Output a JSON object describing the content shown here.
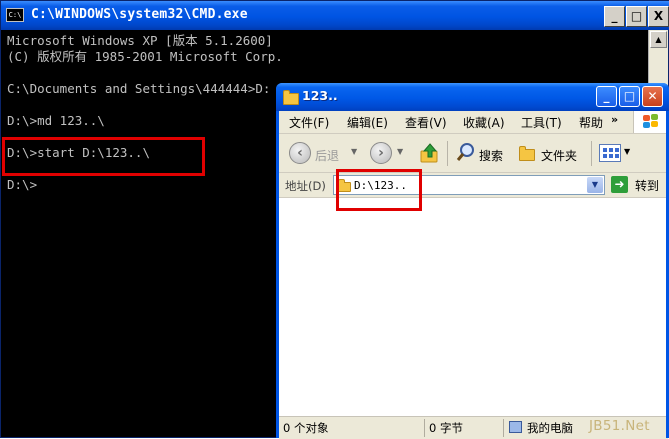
{
  "cmd": {
    "title": "C:\\WINDOWS\\system32\\CMD.exe",
    "icon_text": "C:\\",
    "controls": {
      "minimize": "_",
      "maximize": "□",
      "close": "X"
    },
    "lines": [
      "Microsoft Windows XP [版本 5.1.2600]",
      "(C) 版权所有 1985-2001 Microsoft Corp.",
      "",
      "C:\\Documents and Settings\\444444>D:",
      "",
      "D:\\>md 123..\\",
      "",
      "D:\\>start D:\\123..\\",
      "",
      "D:\\>"
    ]
  },
  "explorer": {
    "title": "123..",
    "controls": {
      "minimize": "_",
      "maximize": "□",
      "close": "✕"
    },
    "menu": [
      "文件(F)",
      "编辑(E)",
      "查看(V)",
      "收藏(A)",
      "工具(T)",
      "帮助"
    ],
    "menu_overflow": "»",
    "toolbar": {
      "back": "后退",
      "search": "搜索",
      "folders": "文件夹"
    },
    "address": {
      "label": "地址(D)",
      "value": "D:\\123..",
      "go": "转到"
    },
    "status": {
      "objects": "0 个对象",
      "size": "0 字节",
      "location": "我的电脑"
    }
  },
  "watermark": "JB51.Net",
  "colors": {
    "highlight": "#e00000",
    "title_bar": "#0054e3",
    "console_text": "#c0c0c0"
  }
}
